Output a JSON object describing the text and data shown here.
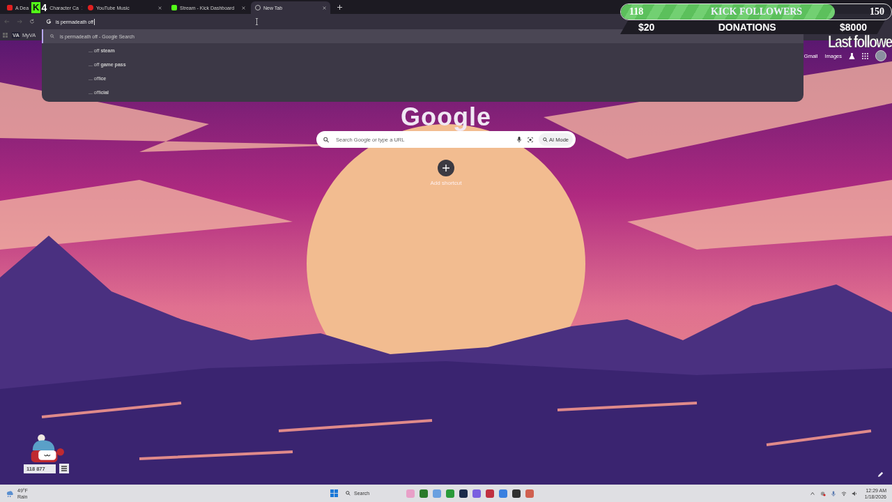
{
  "tabs": [
    {
      "title_start": "A Dea",
      "title": "Character Ca",
      "kind": "youtube",
      "selected": false
    },
    {
      "title": "YouTube Music",
      "kind": "music",
      "selected": false
    },
    {
      "title": "Stream - Kick Dashboard",
      "kind": "kick",
      "selected": false
    },
    {
      "title": "New Tab",
      "kind": "chrome",
      "selected": true
    }
  ],
  "stream_badge": {
    "letter": "K",
    "count": "4"
  },
  "omnibox": {
    "value": "is permadeath off"
  },
  "bookmarks": [
    {
      "icon": "VA",
      "label": "MyVA"
    }
  ],
  "suggestions": [
    {
      "text": "is permadeath off - Google Search",
      "kind": "search",
      "selected": true
    },
    {
      "text": "... off **steam**",
      "kind": "completion",
      "selected": false
    },
    {
      "text": "... off **game pass**",
      "kind": "completion",
      "selected": false
    },
    {
      "text": "... off**ice**",
      "kind": "completion",
      "selected": false
    },
    {
      "text": "... off**icial**",
      "kind": "completion",
      "selected": false
    }
  ],
  "ntp": {
    "links": [
      "Gmail",
      "Images"
    ],
    "logo": "Google",
    "search_placeholder": "Search Google or type a URL",
    "ai_mode": "AI Mode",
    "add_shortcut": "Add shortcut"
  },
  "followers_goal": {
    "current": "118",
    "title": "KICK FOLLOWERS",
    "target": "150",
    "level": 0.79
  },
  "donations_goal": {
    "current": "$20",
    "title": "DONATIONS",
    "target": "$8000"
  },
  "last_follower": "Last followe",
  "counter_widget": {
    "value": "118 877"
  },
  "taskbar": {
    "weather_temp": "49°F",
    "weather_text": "Rain",
    "search": "Search",
    "time": "12:29 AM",
    "date": "1/18/2026"
  }
}
